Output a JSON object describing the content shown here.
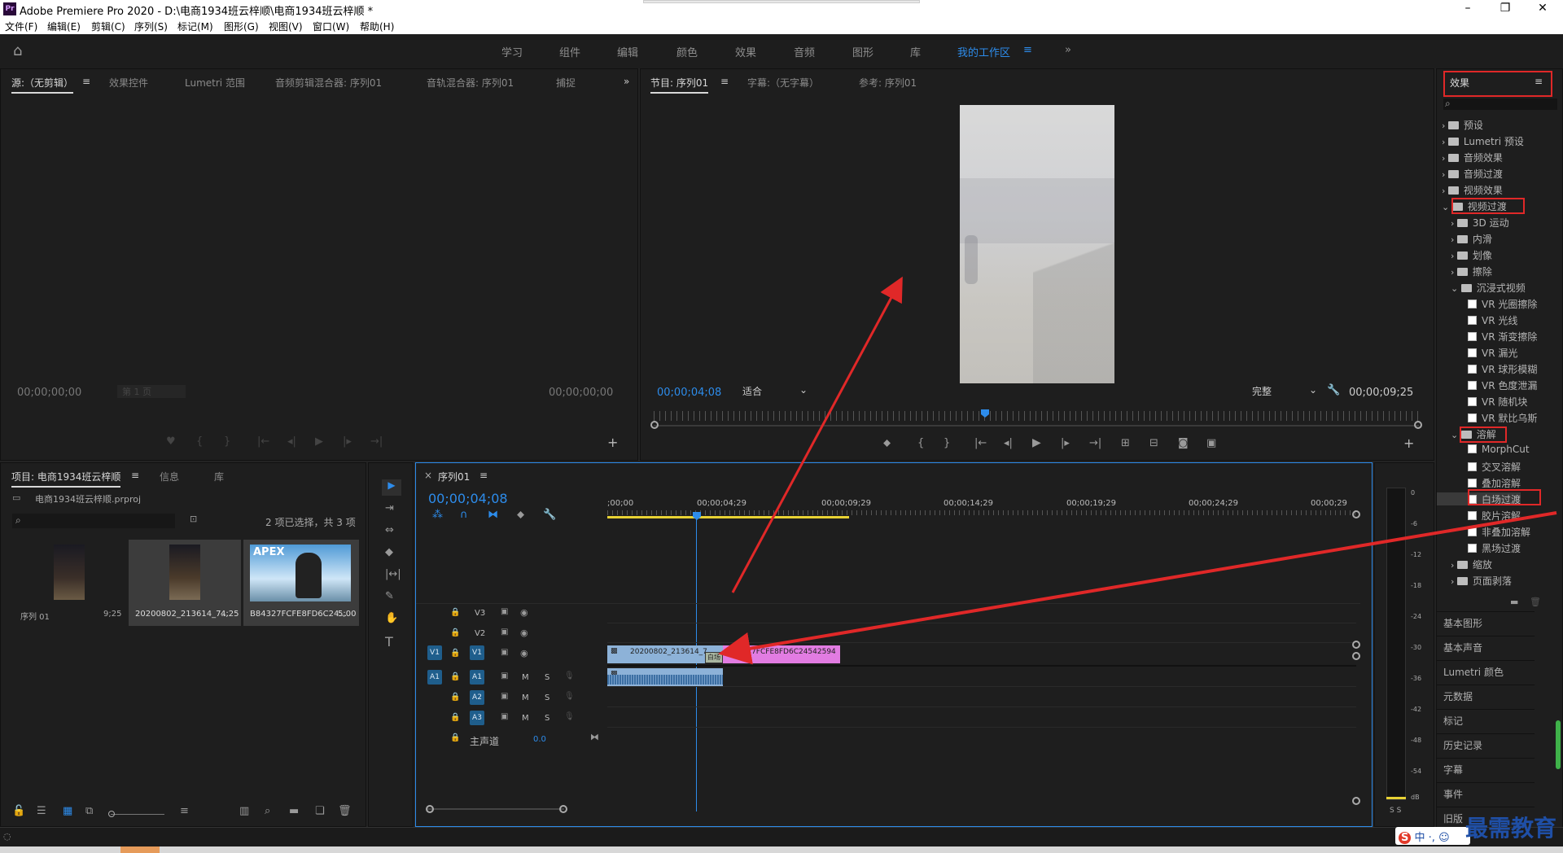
{
  "window": {
    "app_icon": "Pr",
    "title": "Adobe Premiere Pro 2020 - D:\\电商1934班云梓顺\\电商1934班云梓顺 *",
    "min": "–",
    "max": "❐",
    "close": "✕"
  },
  "menu": [
    "文件(F)",
    "编辑(E)",
    "剪辑(C)",
    "序列(S)",
    "标记(M)",
    "图形(G)",
    "视图(V)",
    "窗口(W)",
    "帮助(H)"
  ],
  "workspaces": [
    "学习",
    "组件",
    "编辑",
    "颜色",
    "效果",
    "音频",
    "图形",
    "库",
    "我的工作区"
  ],
  "workspace_more": "»",
  "source_panel": {
    "tabs": [
      "源:（无剪辑）",
      "效果控件",
      "Lumetri 范围",
      "音频剪辑混合器: 序列01",
      "音轨混合器: 序列01",
      "捕捉"
    ],
    "timecode_left": "00;00;00;00",
    "page": "第 1 页",
    "timecode_right": "00;00;00;00"
  },
  "program_panel": {
    "tabs": [
      "节目: 序列01",
      "字幕:（无字幕）",
      "参考: 序列01"
    ],
    "timecode": "00;00;04;08",
    "fit": "适合",
    "quality": "完整",
    "duration": "00;00;09;25"
  },
  "project_panel": {
    "tabs": [
      "项目: 电商1934班云梓顺",
      "信息",
      "库"
    ],
    "file": "电商1934班云梓顺.prproj",
    "selection": "2 项已选择，共 3 项",
    "items": [
      {
        "name": "序列 01",
        "duration": "9;25"
      },
      {
        "name": "20200802_213614_7...",
        "duration": "4;25"
      },
      {
        "name": "B84327FCFE8FD6C24...",
        "duration": "5;00"
      }
    ],
    "thumb_text": "APEX"
  },
  "timeline": {
    "tab": "序列01",
    "timecode": "00;00;04;08",
    "ruler": [
      ";00;00",
      "00;00;04;29",
      "00;00;09;29",
      "00;00;14;29",
      "00;00;19;29",
      "00;00;24;29",
      "00;00;29"
    ],
    "video_tracks": [
      "V3",
      "V2",
      "V1"
    ],
    "audio_tracks": [
      "A1",
      "A2",
      "A3"
    ],
    "source_v": "V1",
    "source_a": "A1",
    "master": "主声道",
    "master_value": "0.0",
    "clip_video_1": "20200802_213614_7",
    "clip_video_2": "B84327FCFE8FD6C24542594",
    "transition_label": "白场",
    "m": "M",
    "s": "S"
  },
  "meter": {
    "scale": [
      "0",
      "-6",
      "-12",
      "-18",
      "-24",
      "-30",
      "-36",
      "-42",
      "-48",
      "-54",
      "dB"
    ],
    "solo": "S S"
  },
  "effects_panel": {
    "title": "效果",
    "tree": [
      {
        "label": "预设",
        "level": 0,
        "type": "folder"
      },
      {
        "label": "Lumetri 预设",
        "level": 0,
        "type": "folder"
      },
      {
        "label": "音频效果",
        "level": 0,
        "type": "folder"
      },
      {
        "label": "音频过渡",
        "level": 0,
        "type": "folder"
      },
      {
        "label": "视频效果",
        "level": 0,
        "type": "folder"
      },
      {
        "label": "视频过渡",
        "level": 0,
        "type": "folder",
        "open": true
      },
      {
        "label": "3D 运动",
        "level": 1,
        "type": "folder"
      },
      {
        "label": "内滑",
        "level": 1,
        "type": "folder"
      },
      {
        "label": "划像",
        "level": 1,
        "type": "folder"
      },
      {
        "label": "擦除",
        "level": 1,
        "type": "folder"
      },
      {
        "label": "沉浸式视频",
        "level": 1,
        "type": "folder",
        "open": true
      },
      {
        "label": "VR 光圈擦除",
        "level": 2,
        "type": "fx"
      },
      {
        "label": "VR 光线",
        "level": 2,
        "type": "fx"
      },
      {
        "label": "VR 渐变擦除",
        "level": 2,
        "type": "fx"
      },
      {
        "label": "VR 漏光",
        "level": 2,
        "type": "fx"
      },
      {
        "label": "VR 球形模糊",
        "level": 2,
        "type": "fx"
      },
      {
        "label": "VR 色度泄漏",
        "level": 2,
        "type": "fx"
      },
      {
        "label": "VR 随机块",
        "level": 2,
        "type": "fx"
      },
      {
        "label": "VR 默比乌斯",
        "level": 2,
        "type": "fx"
      },
      {
        "label": "溶解",
        "level": 1,
        "type": "folder",
        "open": true
      },
      {
        "label": "MorphCut",
        "level": 2,
        "type": "fx"
      },
      {
        "label": "交叉溶解",
        "level": 2,
        "type": "fx"
      },
      {
        "label": "叠加溶解",
        "level": 2,
        "type": "fx"
      },
      {
        "label": "白场过渡",
        "level": 2,
        "type": "fx"
      },
      {
        "label": "胶片溶解",
        "level": 2,
        "type": "fx"
      },
      {
        "label": "非叠加溶解",
        "level": 2,
        "type": "fx"
      },
      {
        "label": "黑场过渡",
        "level": 2,
        "type": "fx"
      },
      {
        "label": "缩放",
        "level": 1,
        "type": "folder"
      },
      {
        "label": "页面剥落",
        "level": 1,
        "type": "folder"
      }
    ],
    "panels": [
      "基本图形",
      "基本声音",
      "Lumetri 颜色",
      "元数据",
      "标记",
      "历史记录",
      "字幕",
      "事件",
      "旧版"
    ]
  },
  "watermark": "最需教育",
  "ime": "中",
  "colors": {
    "accent": "#2d8ceb",
    "annotation": "#e02828",
    "clip_video": "#8db2d8",
    "clip_pink": "#e27ce2",
    "audio": "#4a7fb5"
  }
}
